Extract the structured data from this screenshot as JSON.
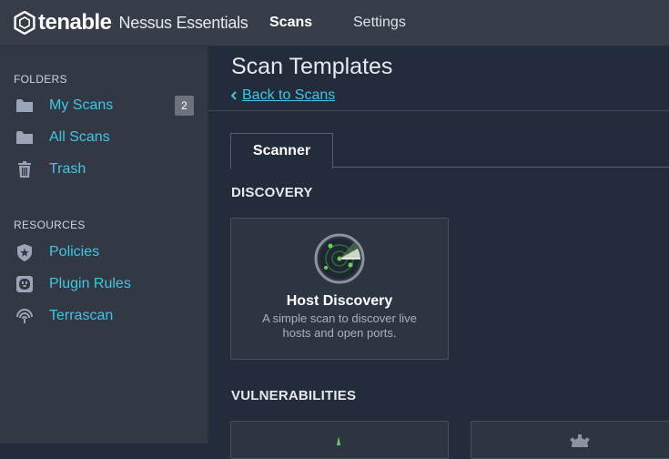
{
  "header": {
    "brand": "tenable",
    "product": "Nessus Essentials",
    "nav": {
      "scans": "Scans",
      "settings": "Settings"
    }
  },
  "sidebar": {
    "folders_heading": "FOLDERS",
    "folders": [
      {
        "label": "My Scans",
        "icon": "folder-icon",
        "badge": "2"
      },
      {
        "label": "All Scans",
        "icon": "folder-icon"
      },
      {
        "label": "Trash",
        "icon": "trash-icon"
      }
    ],
    "resources_heading": "RESOURCES",
    "resources": [
      {
        "label": "Policies",
        "icon": "shield-star-icon"
      },
      {
        "label": "Plugin Rules",
        "icon": "plug-icon"
      },
      {
        "label": "Terrascan",
        "icon": "signal-icon"
      }
    ]
  },
  "main": {
    "title": "Scan Templates",
    "back_link": "Back to Scans",
    "tabs": [
      {
        "label": "Scanner",
        "active": true
      }
    ],
    "sections": {
      "discovery": {
        "title": "DISCOVERY",
        "cards": [
          {
            "title": "Host Discovery",
            "description": "A simple scan to discover live hosts and open ports.",
            "icon": "radar-icon"
          }
        ]
      },
      "vulnerabilities": {
        "title": "VULNERABILITIES"
      }
    }
  },
  "colors": {
    "accent": "#43c4e4",
    "topbar": "#363d48",
    "sidebar": "#323944",
    "main_bg": "#222c3a",
    "card_bg": "#2d3542"
  }
}
